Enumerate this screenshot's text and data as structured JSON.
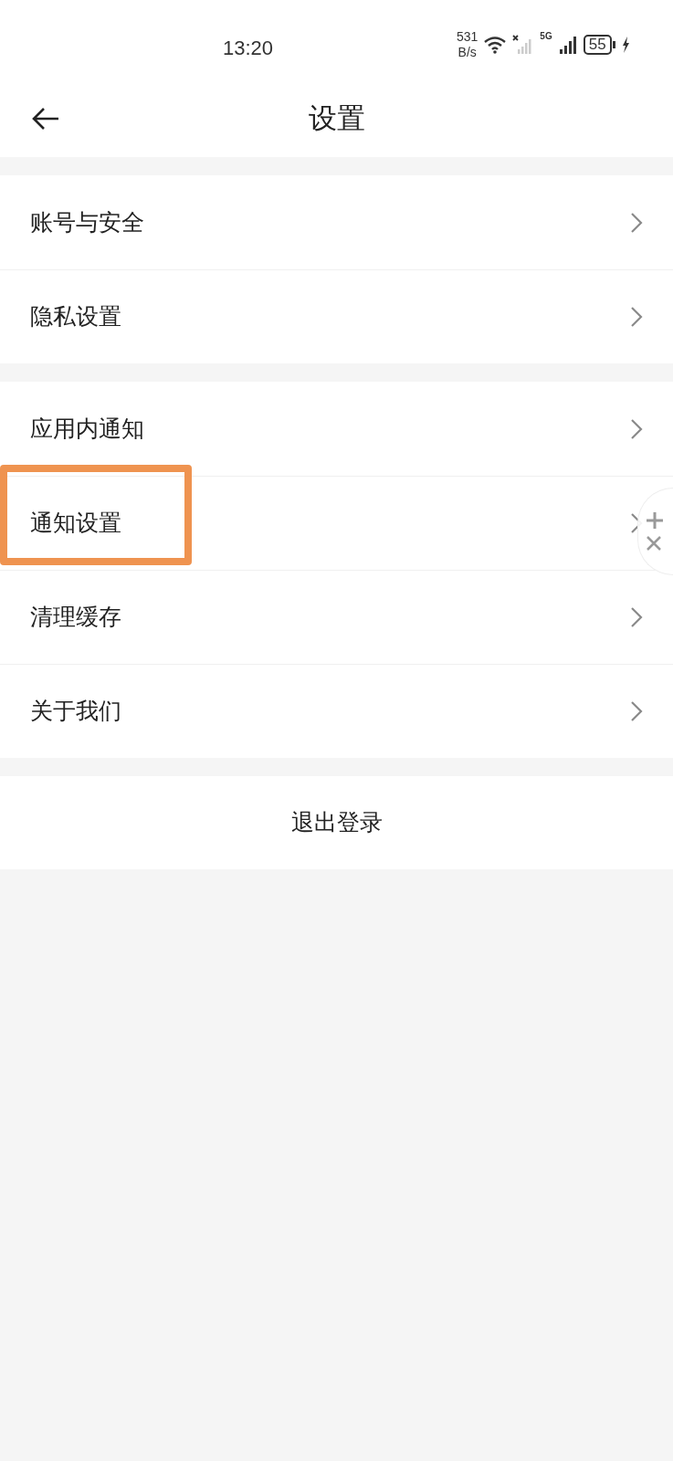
{
  "status_bar": {
    "time": "13:20",
    "net_speed_value": "531",
    "net_speed_unit": "B/s",
    "network_label": "5G",
    "battery": "55"
  },
  "header": {
    "title": "设置"
  },
  "groups": [
    {
      "items": [
        {
          "label": "账号与安全",
          "highlighted": false
        },
        {
          "label": "隐私设置",
          "highlighted": false
        }
      ]
    },
    {
      "items": [
        {
          "label": "应用内通知",
          "highlighted": false
        },
        {
          "label": "通知设置",
          "highlighted": true
        },
        {
          "label": "清理缓存",
          "highlighted": false
        },
        {
          "label": "关于我们",
          "highlighted": false
        }
      ]
    }
  ],
  "logout": {
    "label": "退出登录"
  }
}
